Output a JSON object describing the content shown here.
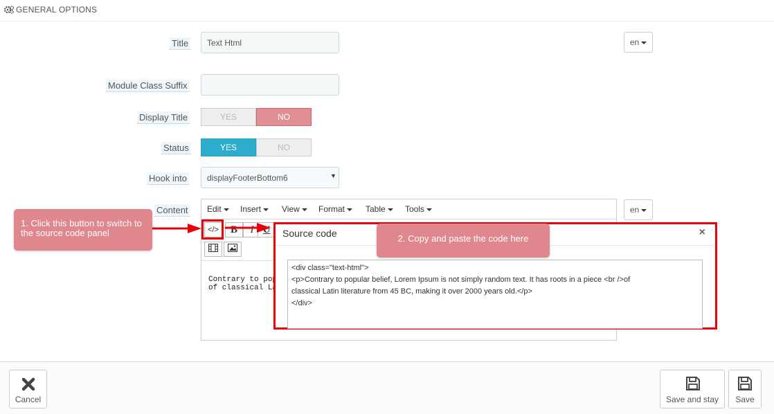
{
  "panel": {
    "title": "GENERAL OPTIONS",
    "icon": "cogs-icon"
  },
  "fields": {
    "title_label": "Title",
    "title_value": "Text Html",
    "lang": "en",
    "suffix_label": "Module Class Suffix",
    "suffix_value": "",
    "display_title_label": "Display Title",
    "display_title_yes": "YES",
    "display_title_no": "NO",
    "display_title_value": "NO",
    "status_label": "Status",
    "status_yes": "YES",
    "status_no": "NO",
    "status_value": "YES",
    "hook_label": "Hook into",
    "hook_value": "displayFooterBottom6",
    "content_label": "Content",
    "content_lang": "en"
  },
  "editor": {
    "menu": [
      "Edit",
      "Insert",
      "View",
      "Format",
      "Table",
      "Tools"
    ],
    "toolbar": {
      "source": "</>",
      "bold": "B",
      "italic": "I",
      "underline": "U"
    },
    "content_line1": "Contrary to popu",
    "content_line2": "of classical Latin"
  },
  "callouts": {
    "step1": "1. Click this button to switch to the source code panel",
    "step2": "2. Copy and paste the code here"
  },
  "modal": {
    "title": "Source code",
    "close": "×",
    "code": [
      "<div class=\"text-html\">",
      "<p>Contrary to popular belief, Lorem Ipsum is not simply random text. It has roots in a piece <br />of",
      "classical Latin literature from 45 BC, making it over 2000 years old.</p>",
      "</div>"
    ]
  },
  "footer": {
    "cancel": "Cancel",
    "save_stay": "Save and stay",
    "save": "Save"
  },
  "colors": {
    "accent_blue": "#2eacce",
    "toggle_red": "#e08f95",
    "highlight_red": "#e8000b",
    "callout": "#e0878e"
  }
}
